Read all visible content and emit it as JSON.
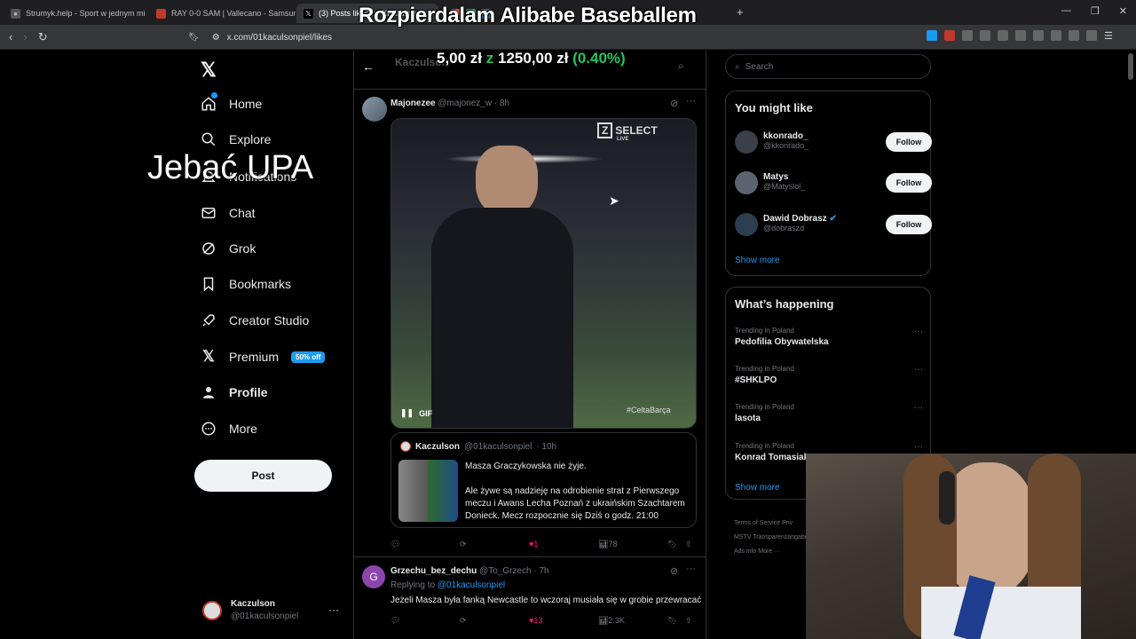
{
  "browser": {
    "tabs": [
      {
        "label": "Strumyk.help - Sport w jednym miej...",
        "active": false
      },
      {
        "label": "RAY 0-0 SAM | Vallecano - Samsunsp...",
        "active": false
      },
      {
        "label": "(3) Posts liked by Kaczulson",
        "active": true
      }
    ],
    "url": "x.com/01kaculsonpiel/likes"
  },
  "overlays": {
    "title": "Rozpierdalam Alibabe Baseballem",
    "price_prefix": "5,00 zł",
    "price_z": "z",
    "price_value": "1250,00 zł",
    "price_pct": "(0.40%)",
    "jebac": "Jebać UPA"
  },
  "nav": {
    "items": [
      {
        "label": "Home",
        "icon": "home-icon"
      },
      {
        "label": "Explore",
        "icon": "search-icon"
      },
      {
        "label": "Notifications",
        "icon": "bell-icon"
      },
      {
        "label": "Chat",
        "icon": "mail-icon"
      },
      {
        "label": "Grok",
        "icon": "grok-icon"
      },
      {
        "label": "Bookmarks",
        "icon": "bookmark-icon"
      },
      {
        "label": "Creator Studio",
        "icon": "rocket-icon"
      },
      {
        "label": "Premium",
        "icon": "x-icon"
      },
      {
        "label": "Profile",
        "icon": "person-icon"
      },
      {
        "label": "More",
        "icon": "more-circle-icon"
      }
    ],
    "premium_badge": "50% off",
    "post_button": "Post"
  },
  "account": {
    "name": "Kaczulson",
    "handle": "@01kaculsonpiel"
  },
  "header": {
    "title": "Kaczulson"
  },
  "tweet1": {
    "name": "Majonezee",
    "handle": "@majonez_w",
    "time": "· 8h",
    "media_watermark": "SELECT",
    "media_watermark_sub": "LIVE",
    "media_gif": "GIF",
    "media_tag": "#CeltaBarça",
    "quote": {
      "name": "Kaczulson",
      "handle": "@01kaculsonpiel",
      "time": "· 10h",
      "line1": "Masza Graczykowska nie żyje.",
      "line2": "Ale żywe są nadzieję na odrobienie strat z Pierwszego meczu i Awans Lecha Poznań z ukraińskim Szachtarem Donieck. Mecz rozpocznie się Dziś o godz. 21:00"
    },
    "likes": "1",
    "views": "78"
  },
  "tweet2": {
    "name": "Grzechu_bez_dechu",
    "handle": "@To_Grzech",
    "time": "· 7h",
    "avatar_letter": "G",
    "replying_prefix": "Replying to",
    "replying_handle": "@01kaculsonpiel",
    "text": "Jeżeli Masza była fanką Newcastle to wczoraj musiała się w grobie przewracać",
    "likes": "13",
    "views": "2.3K"
  },
  "search": {
    "placeholder": "Search"
  },
  "you_might_like": {
    "title": "You might like",
    "users": [
      {
        "name": "kkonrado_",
        "handle": "@kkonrado_",
        "button": "Follow"
      },
      {
        "name": "Matys",
        "handle": "@Matyslol_",
        "button": "Follow"
      },
      {
        "name": "Dawid Dobrasz",
        "handle": "@dobraszd",
        "button": "Follow",
        "verified": true
      }
    ],
    "show_more": "Show more"
  },
  "whats_happening": {
    "title": "What’s happening",
    "trends": [
      {
        "category": "Trending in Poland",
        "topic": "Pedofilia Obywatelska"
      },
      {
        "category": "Trending in Poland",
        "topic": "#SHKLPO"
      },
      {
        "category": "Trending in Poland",
        "topic": "lasota"
      },
      {
        "category": "Trending in Poland",
        "topic": "Konrad Tomasiak"
      }
    ],
    "show_more": "Show more"
  },
  "footer": {
    "links": [
      "Terms of Service",
      "Priv",
      "MSTV Transparenzangabe",
      "Ads info",
      "More ···"
    ]
  },
  "colors": {
    "accent": "#1d9bf0",
    "like": "#f91880",
    "price_green": "#22c55e"
  }
}
